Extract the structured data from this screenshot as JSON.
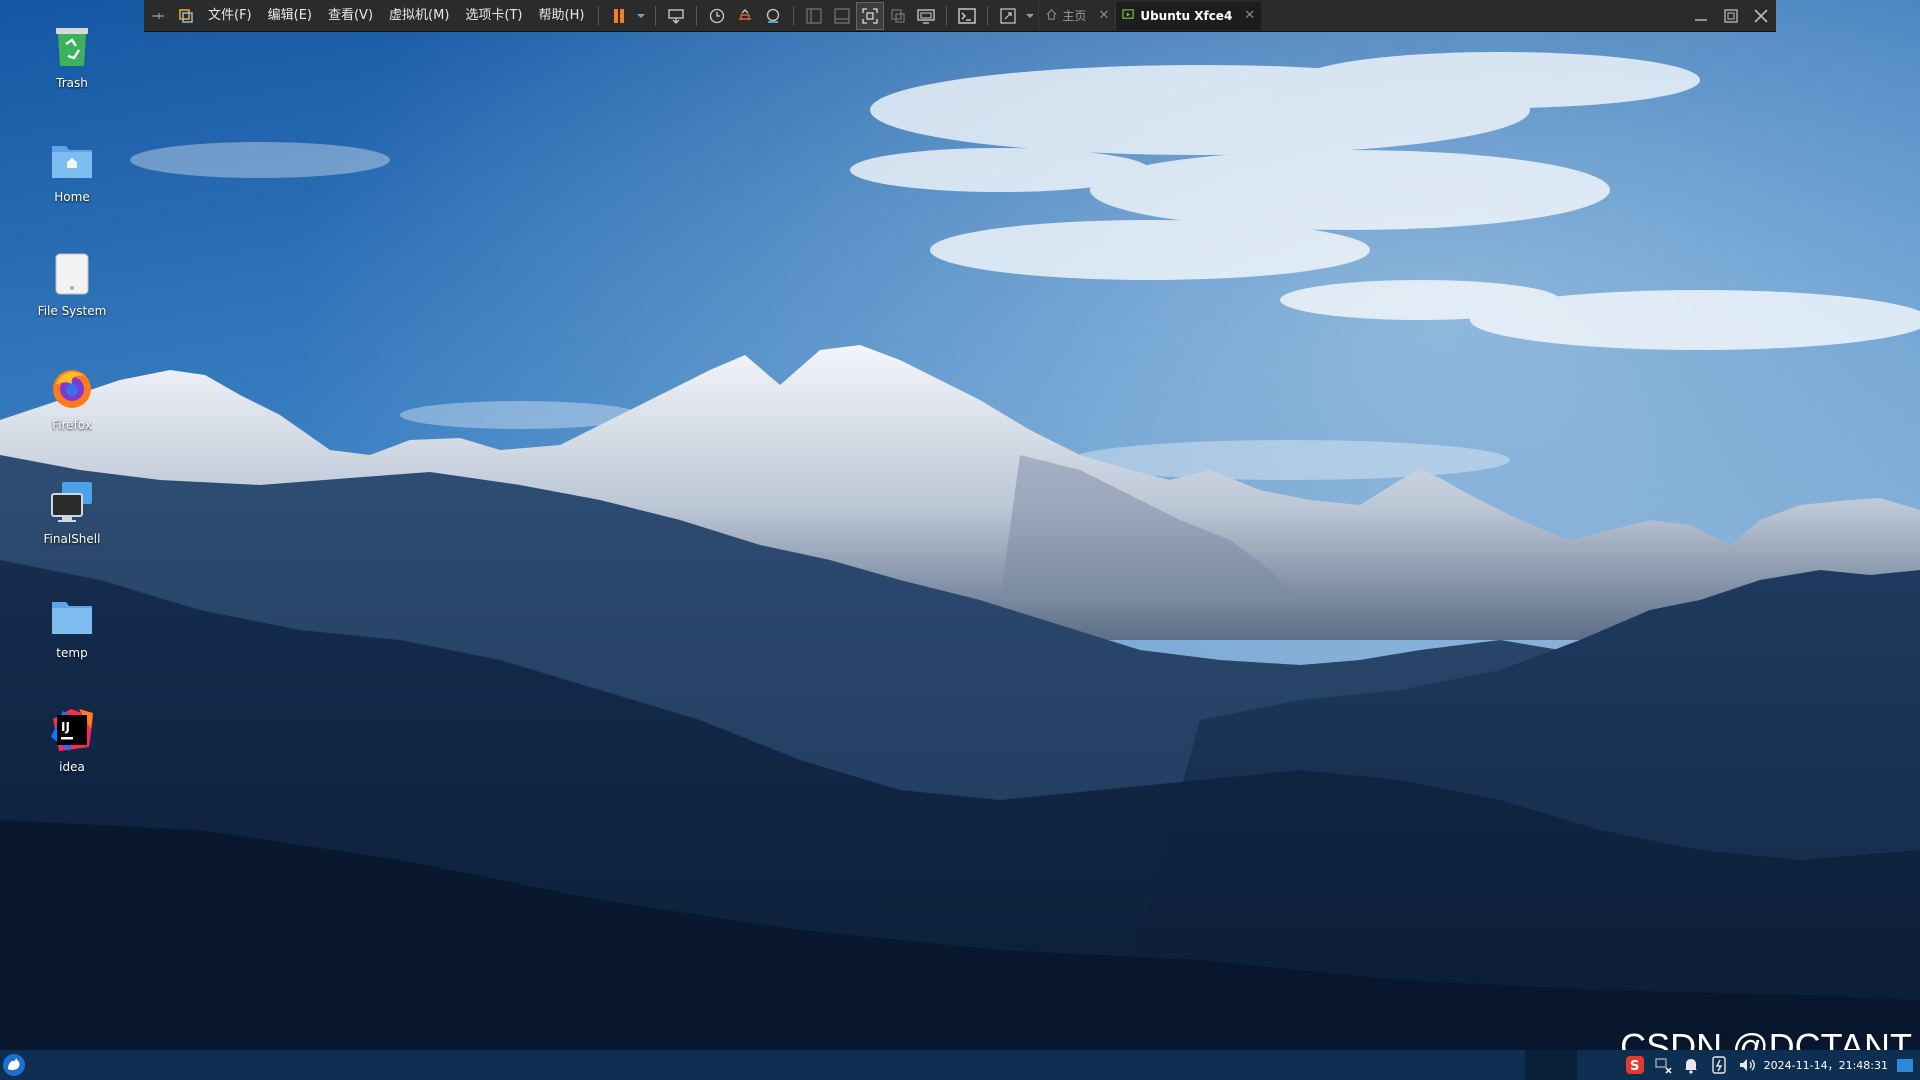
{
  "vm_toolbar": {
    "menus": [
      "文件(F)",
      "编辑(E)",
      "查看(V)",
      "虚拟机(M)",
      "选项卡(T)",
      "帮助(H)"
    ],
    "tabs": [
      {
        "label": "主页",
        "active": false
      },
      {
        "label": "Ubuntu Xfce4",
        "active": true
      }
    ],
    "tab_close_glyph": "✕"
  },
  "desktop": {
    "icons": [
      {
        "label": "Trash",
        "icon": "trash-icon"
      },
      {
        "label": "Home",
        "icon": "home-folder-icon"
      },
      {
        "label": "File System",
        "icon": "drive-icon"
      },
      {
        "label": "Firefox",
        "icon": "firefox-icon"
      },
      {
        "label": "FinalShell",
        "icon": "finalshell-icon"
      },
      {
        "label": "temp",
        "icon": "folder-icon"
      },
      {
        "label": "idea",
        "icon": "intellij-idea-icon"
      }
    ]
  },
  "panel": {
    "clock": "2024-11-14，21:48:31"
  },
  "watermark": "CSDN @DCTANT",
  "colors": {
    "toolbar_bg": "#2b2b2b",
    "panel_bg": "#0f2f52",
    "pause_orange": "#f0821e",
    "sky_top": "#1d5fa8"
  }
}
